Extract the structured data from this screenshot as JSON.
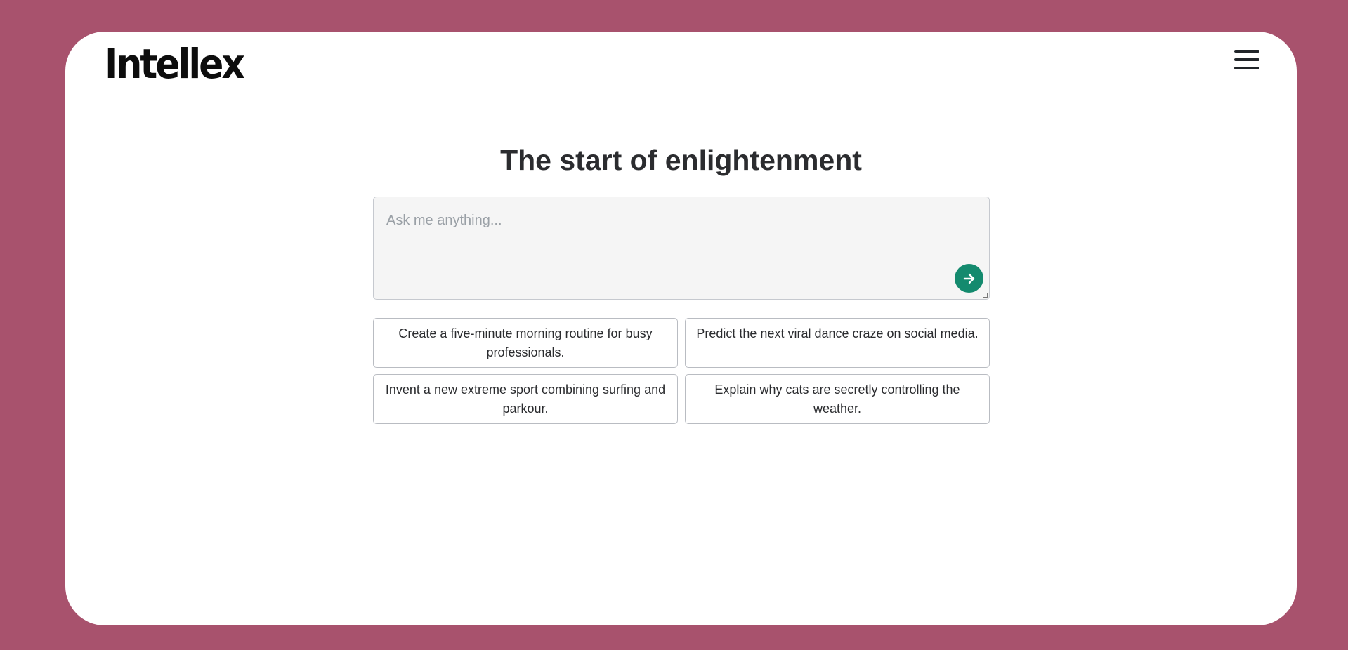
{
  "app": {
    "logo_text": "Intellex",
    "menu_icon": "hamburger-menu-icon"
  },
  "main": {
    "title": "The start of enlightenment",
    "prompt": {
      "placeholder": "Ask me anything...",
      "value": "",
      "send_icon": "arrow-right-icon"
    },
    "suggestions": [
      "Create a five-minute morning routine for busy professionals.",
      "Predict the next viral dance craze on social media.",
      "Invent a new extreme sport combining surfing and parkour.",
      "Explain why cats are secretly controlling the weather."
    ]
  },
  "colors": {
    "background": "#a8526d",
    "card": "#ffffff",
    "accent": "#148a6e",
    "text": "#2b2c2f"
  }
}
